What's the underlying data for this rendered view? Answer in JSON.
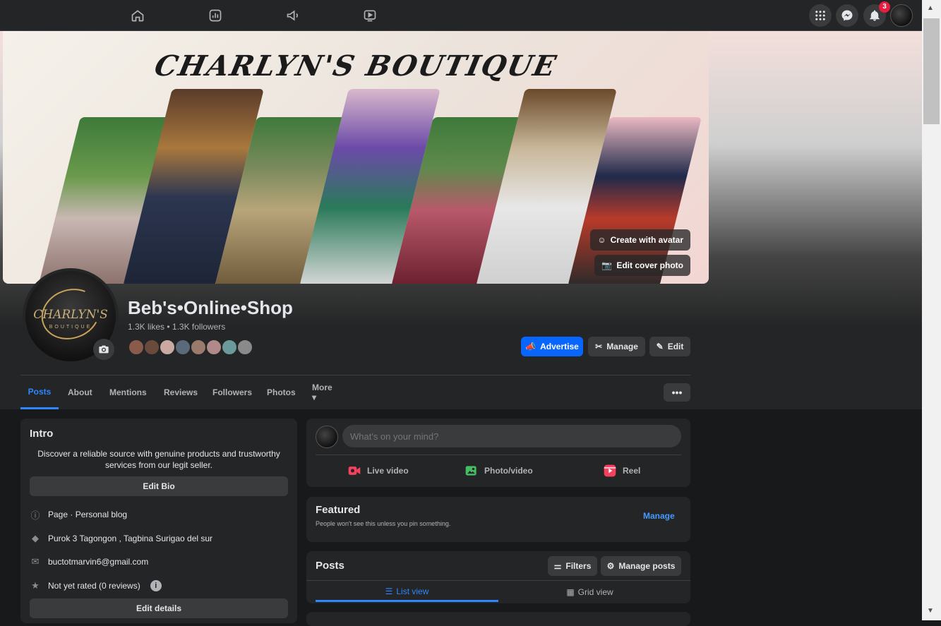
{
  "topbar": {
    "nav_icons": [
      "home-icon",
      "insights-icon",
      "megaphone-icon",
      "video-icon"
    ],
    "notifications_count": "3"
  },
  "cover": {
    "title": "CHARLYN'S BOUTIQUE",
    "create_avatar_label": "Create with avatar",
    "edit_cover_label": "Edit cover photo"
  },
  "profile": {
    "logo_text": "CHARLYN'S",
    "logo_sub": "BOUTIQUE",
    "name": "Beb's•Online•Shop",
    "stats": "1.3K likes • 1.3K followers"
  },
  "actions": {
    "advertise": "Advertise",
    "manage": "Manage",
    "edit": "Edit"
  },
  "tabs": [
    {
      "label": "Posts",
      "active": true
    },
    {
      "label": "About"
    },
    {
      "label": "Mentions"
    },
    {
      "label": "Reviews"
    },
    {
      "label": "Followers"
    },
    {
      "label": "Photos"
    },
    {
      "label": "More ▾"
    }
  ],
  "more_dots": "•••",
  "intro": {
    "title": "Intro",
    "bio": "Discover a reliable source with genuine products and trustworthy services from our legit seller.",
    "edit_bio": "Edit Bio",
    "details": [
      {
        "icon": "info-icon",
        "text": "Page · Personal blog"
      },
      {
        "icon": "location-icon",
        "text": "Purok 3 Tagongon , Tagbina Surigao del sur"
      },
      {
        "icon": "email-icon",
        "text": "buctotmarvin6@gmail.com"
      },
      {
        "icon": "star-icon",
        "text": "Not yet rated (0 reviews)"
      }
    ],
    "edit_details": "Edit details"
  },
  "composer": {
    "placeholder": "What's on your mind?",
    "live_video": "Live video",
    "photo_video": "Photo/video",
    "reel": "Reel"
  },
  "featured": {
    "title": "Featured",
    "subtitle": "People won't see this unless you pin something.",
    "manage": "Manage"
  },
  "posts": {
    "title": "Posts",
    "filters": "Filters",
    "manage_posts": "Manage posts",
    "list_view": "List view",
    "grid_view": "Grid view"
  },
  "colors": {
    "accent": "#0866ff",
    "link": "#2d88ff",
    "surface": "#242526",
    "background": "#18191a"
  }
}
